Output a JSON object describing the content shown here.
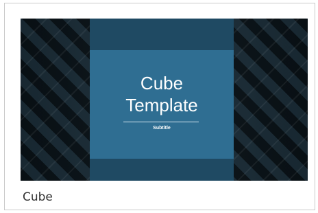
{
  "template": {
    "thumbnail": {
      "title_line1": "Cube",
      "title_line2": "Template",
      "subtitle": "Subtitle"
    },
    "name": "Cube"
  },
  "colors": {
    "background_dark": "#0d1820",
    "center_strip": "#1f4a63",
    "center_box": "#2f6e92",
    "text": "#ffffff"
  }
}
